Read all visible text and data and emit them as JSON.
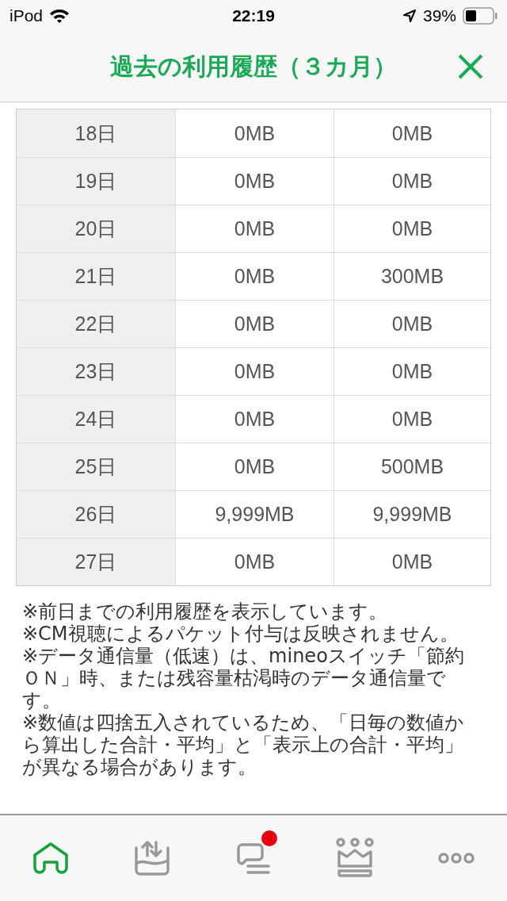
{
  "status_bar": {
    "device": "iPod",
    "time": "22:19",
    "battery": "39%"
  },
  "header": {
    "title": "過去の利用履歴（３カ月）"
  },
  "table": {
    "rows": [
      {
        "day": "18日",
        "column_2": "0MB",
        "column_3": "0MB"
      },
      {
        "day": "19日",
        "column_2": "0MB",
        "column_3": "0MB"
      },
      {
        "day": "20日",
        "column_2": "0MB",
        "column_3": "0MB"
      },
      {
        "day": "21日",
        "column_2": "0MB",
        "column_3": "300MB"
      },
      {
        "day": "22日",
        "column_2": "0MB",
        "column_3": "0MB"
      },
      {
        "day": "23日",
        "column_2": "0MB",
        "column_3": "0MB"
      },
      {
        "day": "24日",
        "column_2": "0MB",
        "column_3": "0MB"
      },
      {
        "day": "25日",
        "column_2": "0MB",
        "column_3": "500MB"
      },
      {
        "day": "26日",
        "column_2": "9,999MB",
        "column_3": "9,999MB"
      },
      {
        "day": "27日",
        "column_2": "0MB",
        "column_3": "0MB"
      }
    ]
  },
  "notes": [
    "※前日までの利用履歴を表示しています。",
    "※CM視聴によるパケット付与は反映されません。",
    "※データ通信量（低速）は、mineoスイッチ「節約ＯＮ」時、または残容量枯渇時のデータ通信量です。",
    "※数値は四捨五入されているため、「日毎の数値から算出した合計・平均」と「表示上の合計・平均」が異なる場合があります。"
  ],
  "tab_bar": [
    {
      "kind": "home",
      "selected": true,
      "notification": false
    },
    {
      "kind": "transfer",
      "selected": false,
      "notification": false
    },
    {
      "kind": "chat",
      "selected": false,
      "notification": true
    },
    {
      "kind": "crown",
      "selected": false,
      "notification": false
    },
    {
      "kind": "more",
      "selected": false,
      "notification": false
    }
  ]
}
